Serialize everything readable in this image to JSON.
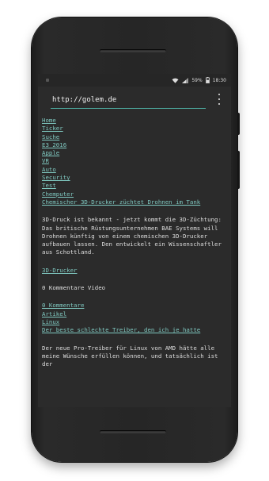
{
  "statusbar": {
    "time": "18:30",
    "percent": "59%"
  },
  "toolbar": {
    "url": "http://golem.de"
  },
  "nav": [
    "Home",
    "Ticker",
    "Suche",
    "E3 2016",
    "Apple",
    "VR",
    "Auto",
    "Security",
    "Test",
    "Chemputer",
    "Chemischer 3D-Drucker züchtet Drohnen im Tank"
  ],
  "article": {
    "intro": "3D-Druck ist bekannt - jetzt kommt die 3D-Züchtung: Das britische Rüstungsunternehmen BAE Systems will Drohnen künftig von einem chemischen 3D-Drucker aufbauen lassen. Den entwickelt ein Wissenschaftler aus Schottland.",
    "category": "3D-Drucker",
    "comments_line": "0 Kommentare Video"
  },
  "links": [
    "0 Kommentare",
    "Artikel",
    "Linux",
    "Der beste schlechte Treiber, den ich je hatte"
  ],
  "teaser": "Der neue Pro-Treiber für Linux von AMD hätte alle meine Wünsche erfüllen können, und tatsächlich ist der"
}
